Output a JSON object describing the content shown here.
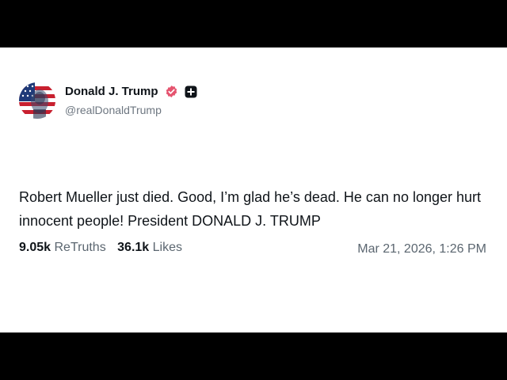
{
  "post": {
    "author": {
      "display_name": "Donald J. Trump",
      "handle": "@realDonaldTrump",
      "avatar_icon": "flag-portrait-avatar",
      "verified_icon": "verified-badge-icon",
      "extra_badge_icon": "plus-badge-icon"
    },
    "text": "Robert Mueller just died. Good, I’m glad he’s dead. He can no longer hurt innocent people! President DONALD J. TRUMP",
    "stats": {
      "retruths_count": "9.05k",
      "retruths_label": "ReTruths",
      "likes_count": "36.1k",
      "likes_label": "Likes"
    },
    "timestamp": "Mar 21, 2026, 1:26 PM"
  },
  "colors": {
    "background": "#ffffff",
    "letterbox": "#000000",
    "text_primary": "#0f1419",
    "text_secondary": "#5b6670",
    "verified_badge": "#e5546f"
  }
}
